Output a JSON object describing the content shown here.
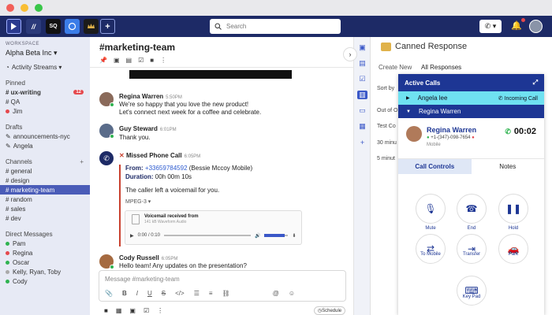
{
  "titlebar": {
    "dots": [
      "close",
      "minimize",
      "zoom"
    ]
  },
  "appbar": {
    "workspaces": [
      {
        "icon": "dialpad-logo",
        "color": "#2a3a8f",
        "text": ""
      },
      {
        "icon": "slash-logo",
        "color": "#2b3a7a",
        "text": "//"
      },
      {
        "icon": "sq-logo",
        "color": "#111111",
        "text": "SQ"
      },
      {
        "icon": "circle-logo",
        "color": "#3b7de8",
        "text": ""
      },
      {
        "icon": "crown-logo",
        "color": "#1b1b1b",
        "text": ""
      }
    ],
    "add_label": "+",
    "search_placeholder": "Search",
    "call_label": "✆ ▾"
  },
  "sidebar": {
    "workspace_label": "WORKSPACE",
    "workspace_name": "Alpha Beta Inc ▾",
    "activity": "Activity Streams ▾",
    "pinned_title": "Pinned",
    "pinned": [
      {
        "label": "# ux-writing",
        "badge": "12",
        "bold": true
      },
      {
        "label": "# QA"
      },
      {
        "label": "Jim",
        "presence": "#e5484d"
      }
    ],
    "drafts_title": "Drafts",
    "drafts": [
      {
        "label": "announcements-nyc",
        "prefix": "✎"
      },
      {
        "label": "Angela",
        "prefix": "✎"
      }
    ],
    "channels_title": "Channels",
    "channels_add": "+",
    "channels": [
      {
        "label": "# general"
      },
      {
        "label": "# design"
      },
      {
        "label": "# marketing-team",
        "active": true
      },
      {
        "label": "# random"
      },
      {
        "label": "# sales"
      },
      {
        "label": "# dev"
      }
    ],
    "dm_title": "Direct Messages",
    "dms": [
      {
        "label": "Pam",
        "presence": "#2fb350"
      },
      {
        "label": "Regina",
        "presence": "#e5484d"
      },
      {
        "label": "Oscar",
        "presence": "#2fb350"
      },
      {
        "label": "Kelly, Ryan, Toby",
        "presence": "#aaaaaa"
      },
      {
        "label": "Cody",
        "presence": "#2fb350"
      }
    ]
  },
  "channel": {
    "title": "#marketing-team",
    "messages": {
      "regina": {
        "name": "Regina Warren",
        "time": "5:50PM",
        "line1": "We're so happy that you love the new product!",
        "line2": "Let's connect next week for a coffee and celebrate."
      },
      "guy": {
        "name": "Guy Steward",
        "time": "6:01PM",
        "line1": "Thank you."
      },
      "missed": {
        "name": "Missed Phone Call",
        "time": "6:05PM",
        "from_label": "From:",
        "from_number": "+33659784592",
        "from_rest": " (Bessie Mccoy Mobile)",
        "duration_label": "Duration:",
        "duration": " 00h 00m 10s",
        "voicemail_note": "The caller left a voicemail for you.",
        "format": "MPEG-3 ▾",
        "audio_title": "Voicemail received from",
        "audio_sub": "141 kB Waveform Audio",
        "audio_time": "0:00 / 0:10"
      },
      "cody": {
        "name": "Cody Russell",
        "time": "6:05PM",
        "line1": "Hello team! Any updates on the presentation?"
      }
    },
    "composer_placeholder": "Message #marketing-team",
    "schedule_label": "Schedule"
  },
  "panel": {
    "title": "Canned Response",
    "tabs": [
      "Create New",
      "All Responses"
    ],
    "sort_label": "Sort by",
    "list": [
      "Out of O",
      "Test Co",
      "30 minu",
      "5 minut"
    ]
  },
  "calls": {
    "title": "Active Calls",
    "row1_name": "Angela lee",
    "row1_status": "Incoming Call",
    "row2_name": "Regina Warren",
    "caller_name": "Regina Warren",
    "caller_number": "+1-(347)-098-7654",
    "caller_kind": "Mobile",
    "timer": "00:02",
    "tabs": [
      "Call Controls",
      "Notes"
    ],
    "controls": [
      "Mute",
      "End",
      "Hold",
      "To Mobile",
      "Transfer",
      "Park",
      "Key Pad"
    ]
  },
  "colors": {
    "brand": "#1d2a66",
    "accent": "#3b58c8",
    "incoming": "#6fe1f1",
    "missed": "#c9412f"
  }
}
